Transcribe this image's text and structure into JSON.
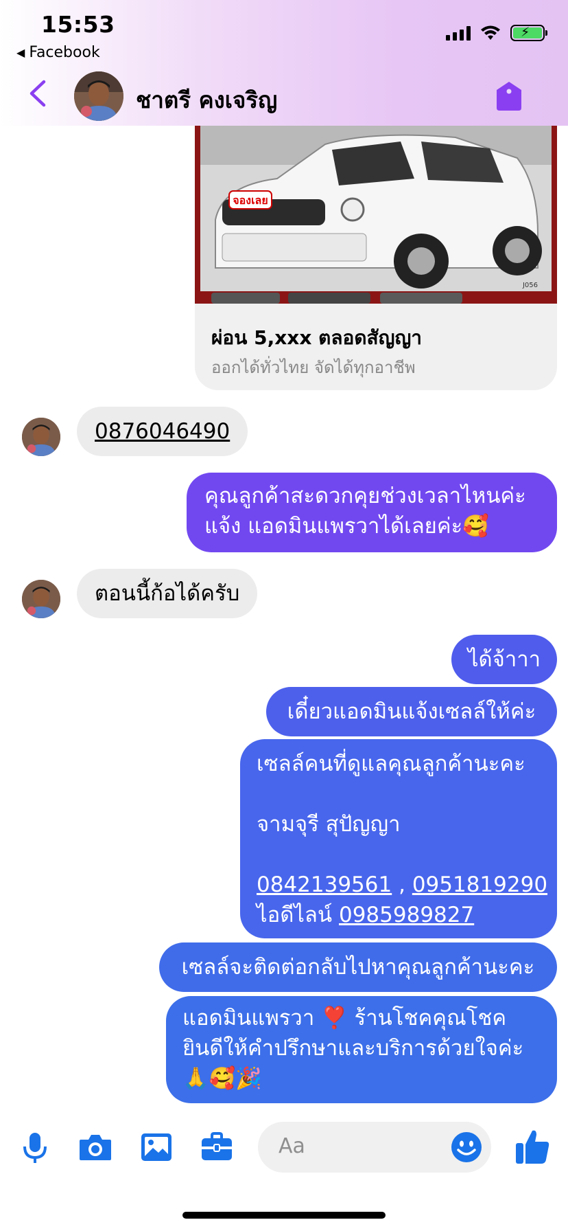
{
  "status_bar": {
    "time": "15:53",
    "back_app": "Facebook"
  },
  "header": {
    "contact_name": "ชาตรี คงเจริญ"
  },
  "product_card": {
    "title": "ผ่อน 5,xxx ตลอดสัญญา",
    "subtitle": "ออกได้ทั่วไทย จัดได้ทุกอาชีพ",
    "sticker_text": "จองเลย",
    "plate_code": "J056"
  },
  "messages": [
    {
      "side": "incoming",
      "text": "0876046490",
      "link": true
    },
    {
      "side": "outgoing",
      "lines": [
        "คุณลูกค้าสะดวกคุยช่วงเวลาไหนค่ะ",
        "แจ้ง แอดมินแพรวาได้เลยค่ะ🥰"
      ]
    },
    {
      "side": "incoming",
      "text": "ตอนนี้ก้อได้ครับ"
    },
    {
      "side": "outgoing",
      "text": "ได้จ้าาา"
    },
    {
      "side": "outgoing",
      "text": "เดี๋ยวแอดมินแจ้งเซลล์ให้ค่ะ"
    },
    {
      "side": "outgoing",
      "line1": "เซลล์คนที่ดูแลคุณลูกค้านะคะ",
      "line2": "จามจุรี สุปัญญา",
      "phone1": "0842139561",
      "separator": ",",
      "phone2": "0951819290",
      "line_label": "ไอดีไลน์",
      "line_id": "0985989827"
    },
    {
      "side": "outgoing",
      "text": "เซลล์จะติดต่อกลับไปหาคุณลูกค้านะคะ"
    },
    {
      "side": "outgoing",
      "lines": [
        "แอดมินแพรวา ❣️ ร้านโชคคุณโชค",
        "ยินดีให้คำปรึกษาและบริการด้วยใจค่ะ",
        "🙏🥰🎉"
      ]
    }
  ],
  "composer": {
    "placeholder": "Aa"
  },
  "colors": {
    "outgoing_top": "#7a4ef2",
    "outgoing_bottom": "#3a6ee8",
    "accent": "#8a3ff0",
    "icon_blue": "#1a73e8",
    "incoming_bg": "#ececec"
  },
  "icons": [
    "back-chevron-icon",
    "tag-icon",
    "microphone-icon",
    "camera-icon",
    "image-icon",
    "briefcase-icon",
    "emoji-icon",
    "like-icon"
  ]
}
